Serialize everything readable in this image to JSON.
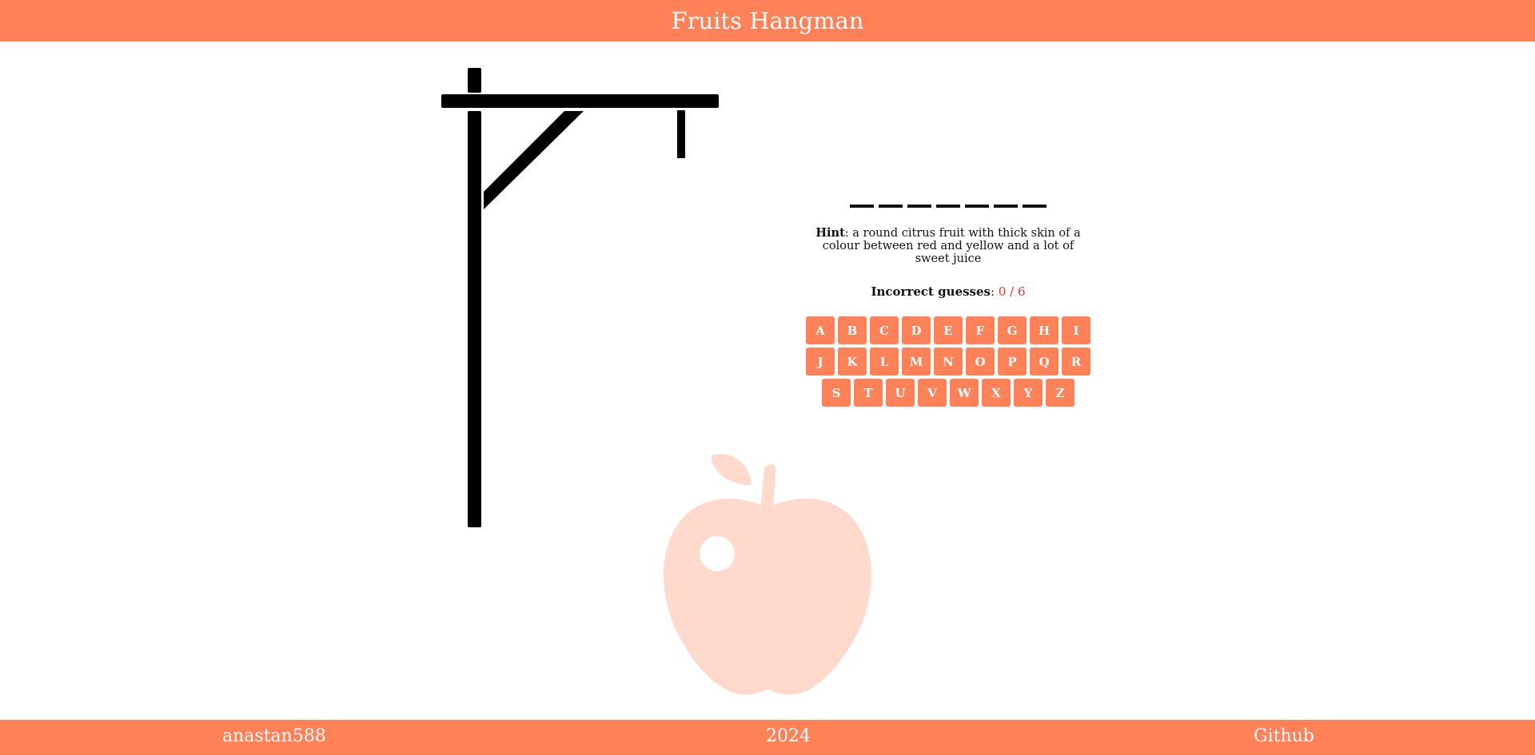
{
  "header": {
    "title": "Fruits Hangman"
  },
  "game": {
    "word_length": 7,
    "hint_label": "Hint",
    "hint_text": ": a round citrus fruit with thick skin of a colour between red and yellow and a lot of sweet juice",
    "guesses_label": "Incorrect guesses",
    "guesses_sep": ": ",
    "guesses_count": "0 / 6"
  },
  "keyboard": {
    "rows": [
      [
        "A",
        "B",
        "C",
        "D",
        "E",
        "F",
        "G",
        "H",
        "I"
      ],
      [
        "J",
        "K",
        "L",
        "M",
        "N",
        "O",
        "P",
        "Q",
        "R"
      ],
      [
        "S",
        "T",
        "U",
        "V",
        "W",
        "X",
        "Y",
        "Z"
      ]
    ]
  },
  "footer": {
    "author": "anastan588",
    "year": "2024",
    "github_label": "Github"
  },
  "colors": {
    "accent": "#ff8157",
    "apple": "#ffd9cc",
    "incorrect_count": "#ef2b21"
  },
  "icons": {
    "apple": "apple-icon",
    "gallows": "gallows-drawing"
  }
}
